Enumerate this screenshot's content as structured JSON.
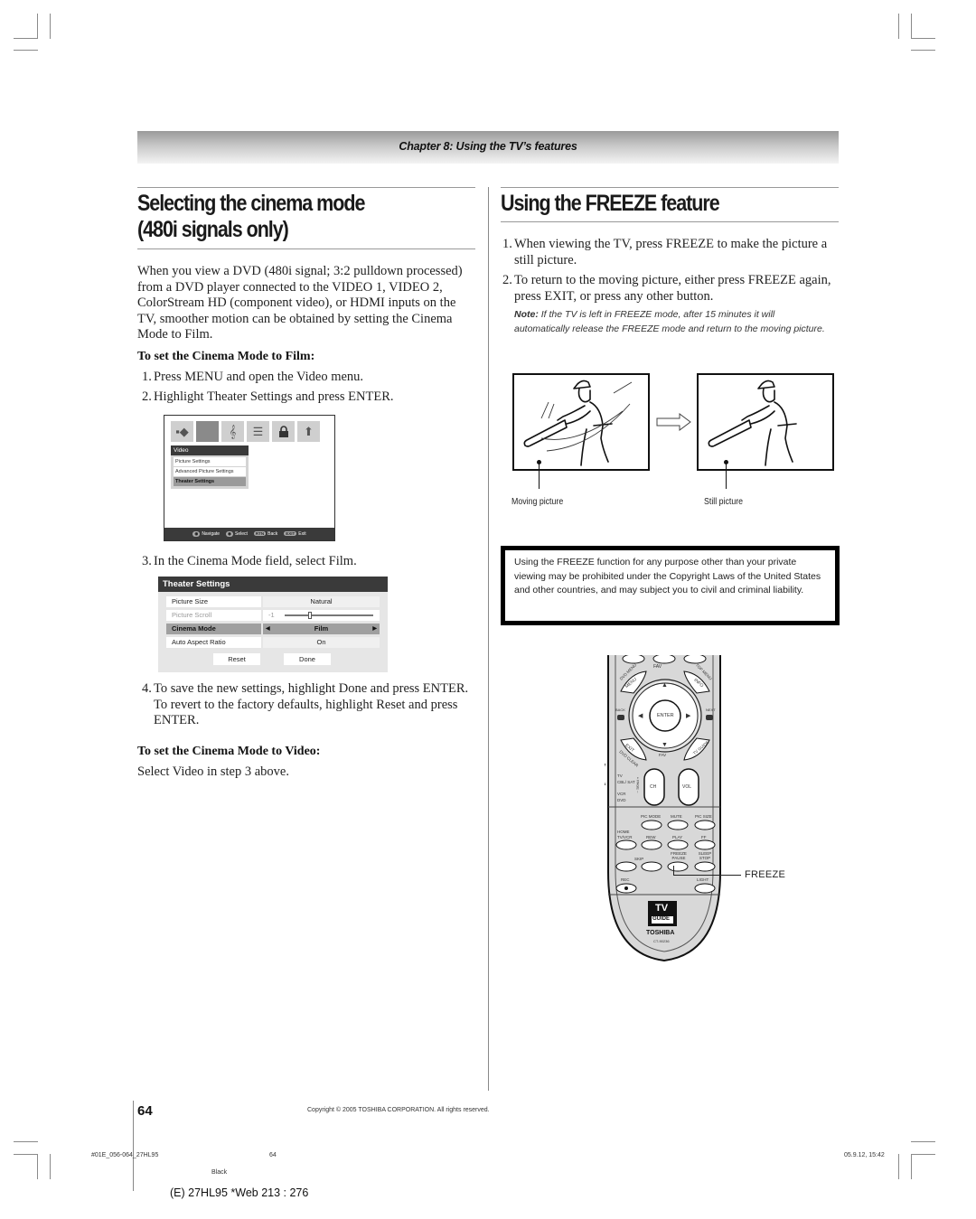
{
  "header": {
    "chapter_title": "Chapter 8: Using the TV’s features"
  },
  "left": {
    "heading_line1": "Selecting the cinema mode",
    "heading_line2": "(480i signals only)",
    "intro": "When you view a DVD (480i signal; 3:2 pulldown processed) from a DVD player connected to the VIDEO 1, VIDEO 2, ColorStream HD (component video), or HDMI inputs on the TV, smoother motion can be obtained by setting the Cinema Mode to Film.",
    "film_heading": "To set the Cinema Mode to Film:",
    "steps": [
      {
        "num": "1.",
        "text": "Press MENU and open the Video menu."
      },
      {
        "num": "2.",
        "text": "Highlight Theater Settings and press ENTER."
      },
      {
        "num": "3.",
        "text": "In the Cinema Mode field, select Film."
      },
      {
        "num": "4.",
        "text": "To save the new settings, highlight Done and press ENTER. To revert to the factory defaults, highlight Reset and press ENTER."
      }
    ],
    "video_heading": "To set the Cinema Mode to Video:",
    "video_text": "Select Video in step 3 above."
  },
  "video_menu_screen": {
    "icons": [
      "video-input-icon",
      "picture-icon",
      "audio-icon",
      "preferences-icon",
      "lock-icon",
      "setup-icon"
    ],
    "icon_glyphs": [
      "▪◆",
      "▬",
      "𝄞",
      "☰",
      "🔒",
      "⬆"
    ],
    "menu_title": "Video",
    "items": [
      "Picture Settings",
      "Advanced Picture Settings",
      "Theater Settings"
    ],
    "selected_index": 2,
    "footer": [
      {
        "key": "◉",
        "label": "Navigate"
      },
      {
        "key": "◉",
        "label": "Select"
      },
      {
        "key": "RTN",
        "label": "Back"
      },
      {
        "key": "EXIT",
        "label": "Exit"
      }
    ]
  },
  "theater_settings_screen": {
    "title": "Theater Settings",
    "rows": [
      {
        "label": "Picture Size",
        "value": "Natural"
      },
      {
        "label": "Picture Scroll",
        "value": "-1"
      },
      {
        "label": "Cinema Mode",
        "value": "Film"
      },
      {
        "label": "Auto Aspect Ratio",
        "value": "On"
      }
    ],
    "arrow_left": "◀",
    "arrow_right": "▶",
    "reset_label": "Reset",
    "done_label": "Done"
  },
  "right": {
    "heading": "Using the FREEZE feature",
    "steps": [
      {
        "num": "1.",
        "text": "When viewing the TV, press FREEZE to make the picture a still picture."
      },
      {
        "num": "2.",
        "text": "To return to the moving picture, either press FREEZE again, press EXIT, or press any other button."
      }
    ],
    "note_label": "Note:",
    "note_text": " If the TV is left in FREEZE mode, after 15 minutes it will automatically release the FREEZE mode and return to the moving picture.",
    "moving_caption": "Moving picture",
    "still_caption": "Still picture",
    "warning": "Using the FREEZE function for any purpose other than your private viewing may be prohibited under the Copyright Laws of the United States and other countries, and may subject you to civil and criminal liability."
  },
  "remote": {
    "labels": {
      "dvd_menu": "DVD MENU",
      "menu": "MENU",
      "fav_up": "FAV",
      "top_menu": "TOP MENU",
      "info": "INFO",
      "back": "BACK",
      "enter": "ENTER",
      "next": "NEXT",
      "exit": "EXIT",
      "tv_guide": "TV GUIDE",
      "dvd_clear": "DVD CLEAR",
      "fav_down": "FAV",
      "ch": "CH",
      "vol": "VOL",
      "page": "+ PAGE –",
      "tv": "TV",
      "cbl_sat": "CBL/ SAT",
      "vcr": "VCR",
      "dvd": "DVD",
      "pic_mode": "PIC MODE",
      "mute": "MUTE",
      "pic_size": "PIC SIZE",
      "home": "HOME",
      "tv_vcr": "TV/VCR",
      "rew": "REW",
      "play": "PLAY",
      "ff": "FF",
      "skip": "SKIP",
      "freeze_pause": "FREEZE PAUSE",
      "sleep_stop": "SLEEP STOP",
      "rec": "REC",
      "light": "LIGHT",
      "tv_guide_logo_top": "TV",
      "tv_guide_logo_bottom": "GUIDE",
      "brand": "TOSHIBA",
      "model": "CT-90236"
    },
    "callout": "FREEZE"
  },
  "footer": {
    "page_number": "64",
    "copyright": "Copyright © 2005 TOSHIBA CORPORATION. All rights reserved.",
    "file_id": "#01E_056-064_27HL95",
    "slug_page": "64",
    "timestamp": "05.9.12, 15:42",
    "color_plate": "Black",
    "web_ref": "(E) 27HL95 *Web 213 : 276"
  }
}
